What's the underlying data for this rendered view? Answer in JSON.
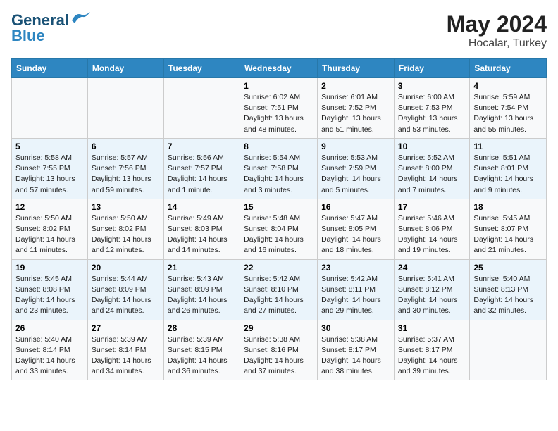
{
  "logo": {
    "line1": "General",
    "line2": "Blue"
  },
  "title": {
    "month_year": "May 2024",
    "location": "Hocalar, Turkey"
  },
  "days_of_week": [
    "Sunday",
    "Monday",
    "Tuesday",
    "Wednesday",
    "Thursday",
    "Friday",
    "Saturday"
  ],
  "weeks": [
    [
      {
        "day": "",
        "sunrise": "",
        "sunset": "",
        "daylight": ""
      },
      {
        "day": "",
        "sunrise": "",
        "sunset": "",
        "daylight": ""
      },
      {
        "day": "",
        "sunrise": "",
        "sunset": "",
        "daylight": ""
      },
      {
        "day": "1",
        "sunrise": "Sunrise: 6:02 AM",
        "sunset": "Sunset: 7:51 PM",
        "daylight": "Daylight: 13 hours and 48 minutes."
      },
      {
        "day": "2",
        "sunrise": "Sunrise: 6:01 AM",
        "sunset": "Sunset: 7:52 PM",
        "daylight": "Daylight: 13 hours and 51 minutes."
      },
      {
        "day": "3",
        "sunrise": "Sunrise: 6:00 AM",
        "sunset": "Sunset: 7:53 PM",
        "daylight": "Daylight: 13 hours and 53 minutes."
      },
      {
        "day": "4",
        "sunrise": "Sunrise: 5:59 AM",
        "sunset": "Sunset: 7:54 PM",
        "daylight": "Daylight: 13 hours and 55 minutes."
      }
    ],
    [
      {
        "day": "5",
        "sunrise": "Sunrise: 5:58 AM",
        "sunset": "Sunset: 7:55 PM",
        "daylight": "Daylight: 13 hours and 57 minutes."
      },
      {
        "day": "6",
        "sunrise": "Sunrise: 5:57 AM",
        "sunset": "Sunset: 7:56 PM",
        "daylight": "Daylight: 13 hours and 59 minutes."
      },
      {
        "day": "7",
        "sunrise": "Sunrise: 5:56 AM",
        "sunset": "Sunset: 7:57 PM",
        "daylight": "Daylight: 14 hours and 1 minute."
      },
      {
        "day": "8",
        "sunrise": "Sunrise: 5:54 AM",
        "sunset": "Sunset: 7:58 PM",
        "daylight": "Daylight: 14 hours and 3 minutes."
      },
      {
        "day": "9",
        "sunrise": "Sunrise: 5:53 AM",
        "sunset": "Sunset: 7:59 PM",
        "daylight": "Daylight: 14 hours and 5 minutes."
      },
      {
        "day": "10",
        "sunrise": "Sunrise: 5:52 AM",
        "sunset": "Sunset: 8:00 PM",
        "daylight": "Daylight: 14 hours and 7 minutes."
      },
      {
        "day": "11",
        "sunrise": "Sunrise: 5:51 AM",
        "sunset": "Sunset: 8:01 PM",
        "daylight": "Daylight: 14 hours and 9 minutes."
      }
    ],
    [
      {
        "day": "12",
        "sunrise": "Sunrise: 5:50 AM",
        "sunset": "Sunset: 8:02 PM",
        "daylight": "Daylight: 14 hours and 11 minutes."
      },
      {
        "day": "13",
        "sunrise": "Sunrise: 5:50 AM",
        "sunset": "Sunset: 8:02 PM",
        "daylight": "Daylight: 14 hours and 12 minutes."
      },
      {
        "day": "14",
        "sunrise": "Sunrise: 5:49 AM",
        "sunset": "Sunset: 8:03 PM",
        "daylight": "Daylight: 14 hours and 14 minutes."
      },
      {
        "day": "15",
        "sunrise": "Sunrise: 5:48 AM",
        "sunset": "Sunset: 8:04 PM",
        "daylight": "Daylight: 14 hours and 16 minutes."
      },
      {
        "day": "16",
        "sunrise": "Sunrise: 5:47 AM",
        "sunset": "Sunset: 8:05 PM",
        "daylight": "Daylight: 14 hours and 18 minutes."
      },
      {
        "day": "17",
        "sunrise": "Sunrise: 5:46 AM",
        "sunset": "Sunset: 8:06 PM",
        "daylight": "Daylight: 14 hours and 19 minutes."
      },
      {
        "day": "18",
        "sunrise": "Sunrise: 5:45 AM",
        "sunset": "Sunset: 8:07 PM",
        "daylight": "Daylight: 14 hours and 21 minutes."
      }
    ],
    [
      {
        "day": "19",
        "sunrise": "Sunrise: 5:45 AM",
        "sunset": "Sunset: 8:08 PM",
        "daylight": "Daylight: 14 hours and 23 minutes."
      },
      {
        "day": "20",
        "sunrise": "Sunrise: 5:44 AM",
        "sunset": "Sunset: 8:09 PM",
        "daylight": "Daylight: 14 hours and 24 minutes."
      },
      {
        "day": "21",
        "sunrise": "Sunrise: 5:43 AM",
        "sunset": "Sunset: 8:09 PM",
        "daylight": "Daylight: 14 hours and 26 minutes."
      },
      {
        "day": "22",
        "sunrise": "Sunrise: 5:42 AM",
        "sunset": "Sunset: 8:10 PM",
        "daylight": "Daylight: 14 hours and 27 minutes."
      },
      {
        "day": "23",
        "sunrise": "Sunrise: 5:42 AM",
        "sunset": "Sunset: 8:11 PM",
        "daylight": "Daylight: 14 hours and 29 minutes."
      },
      {
        "day": "24",
        "sunrise": "Sunrise: 5:41 AM",
        "sunset": "Sunset: 8:12 PM",
        "daylight": "Daylight: 14 hours and 30 minutes."
      },
      {
        "day": "25",
        "sunrise": "Sunrise: 5:40 AM",
        "sunset": "Sunset: 8:13 PM",
        "daylight": "Daylight: 14 hours and 32 minutes."
      }
    ],
    [
      {
        "day": "26",
        "sunrise": "Sunrise: 5:40 AM",
        "sunset": "Sunset: 8:14 PM",
        "daylight": "Daylight: 14 hours and 33 minutes."
      },
      {
        "day": "27",
        "sunrise": "Sunrise: 5:39 AM",
        "sunset": "Sunset: 8:14 PM",
        "daylight": "Daylight: 14 hours and 34 minutes."
      },
      {
        "day": "28",
        "sunrise": "Sunrise: 5:39 AM",
        "sunset": "Sunset: 8:15 PM",
        "daylight": "Daylight: 14 hours and 36 minutes."
      },
      {
        "day": "29",
        "sunrise": "Sunrise: 5:38 AM",
        "sunset": "Sunset: 8:16 PM",
        "daylight": "Daylight: 14 hours and 37 minutes."
      },
      {
        "day": "30",
        "sunrise": "Sunrise: 5:38 AM",
        "sunset": "Sunset: 8:17 PM",
        "daylight": "Daylight: 14 hours and 38 minutes."
      },
      {
        "day": "31",
        "sunrise": "Sunrise: 5:37 AM",
        "sunset": "Sunset: 8:17 PM",
        "daylight": "Daylight: 14 hours and 39 minutes."
      },
      {
        "day": "",
        "sunrise": "",
        "sunset": "",
        "daylight": ""
      }
    ]
  ]
}
